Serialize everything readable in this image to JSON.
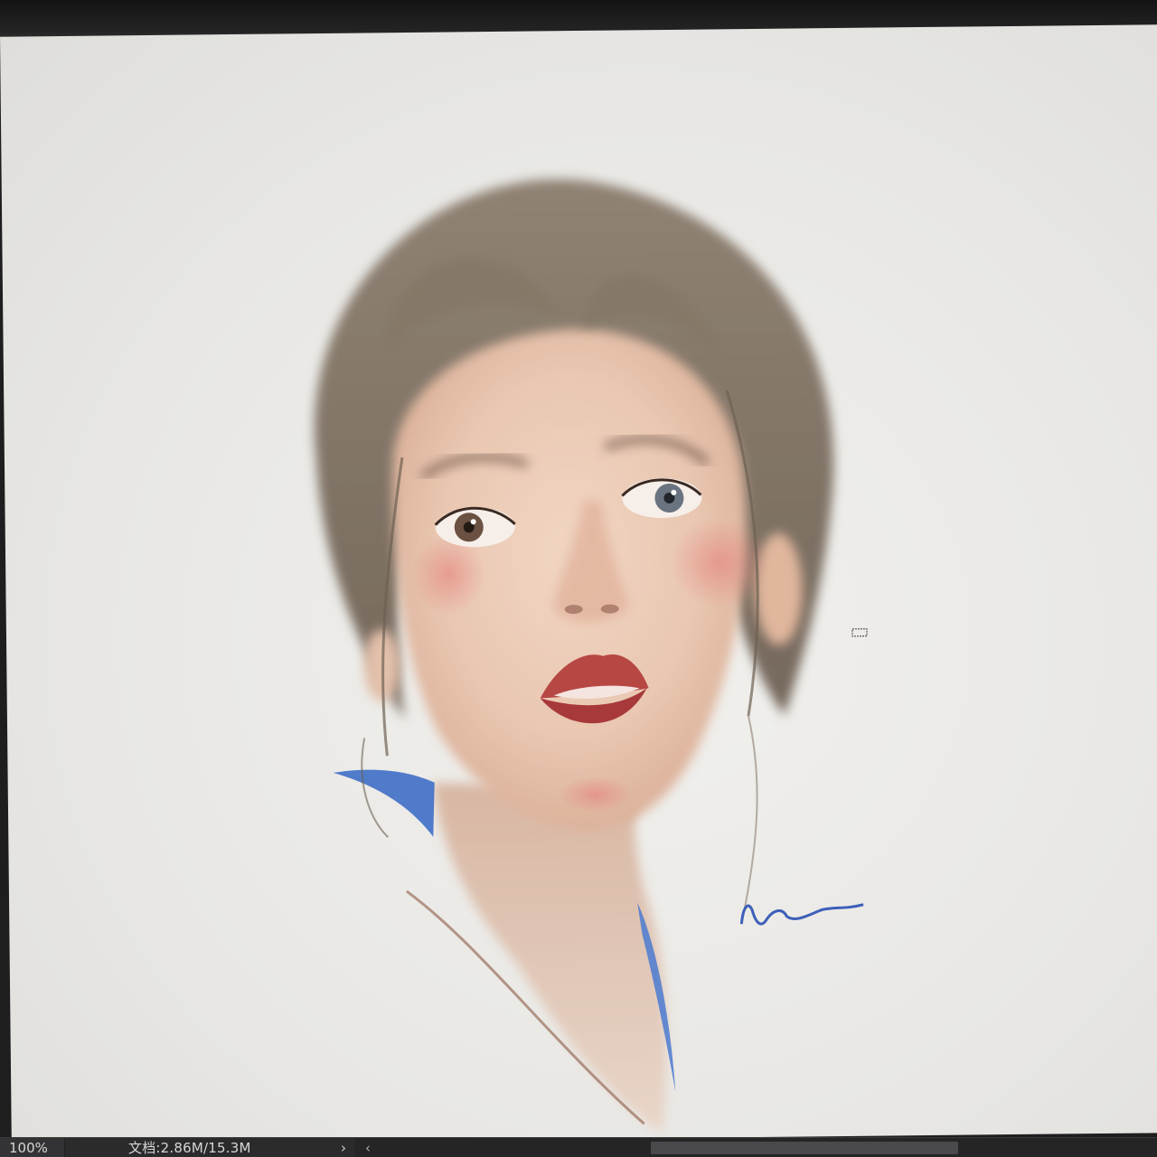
{
  "status_bar": {
    "zoom": "100%",
    "document_info": "文档:2.86M/15.3M",
    "nav_arrow": "›",
    "scroll_left_arrow": "‹"
  },
  "canvas": {
    "background_color": "#ecebe8",
    "artwork": "digital-painting-portrait"
  },
  "icons": {
    "nav_arrow": "chevron-right-icon",
    "scroll_left": "chevron-left-icon",
    "cursor": "brush-cursor-icon"
  }
}
